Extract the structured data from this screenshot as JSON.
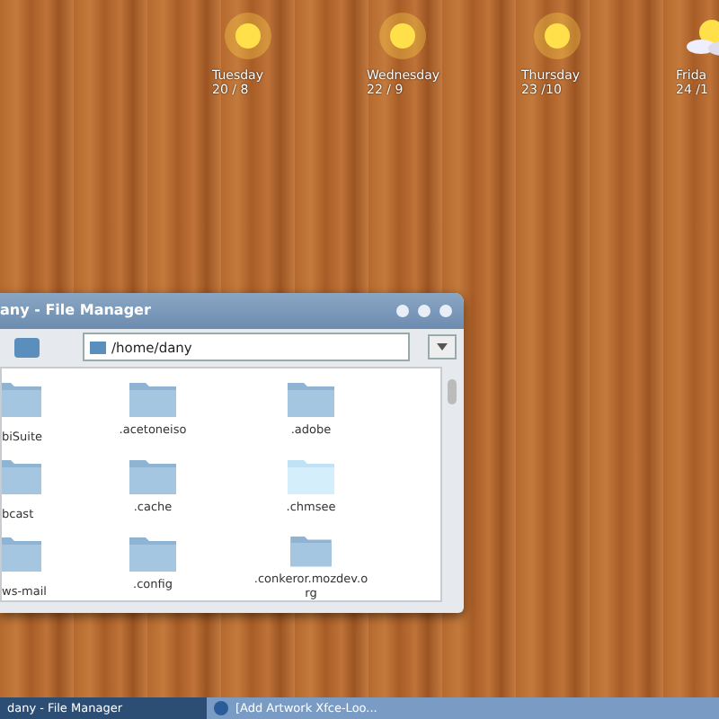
{
  "weather": [
    {
      "day": "Tuesday",
      "date": "20 / 8",
      "kind": "sunny"
    },
    {
      "day": "Wednesday",
      "date": "22 / 9",
      "kind": "sunny"
    },
    {
      "day": "Thursday",
      "date": "23 /10",
      "kind": "sunny"
    },
    {
      "day": "Frida",
      "date": "24 /1",
      "kind": "cloudy"
    }
  ],
  "window": {
    "title": "any - File Manager",
    "location": "/home/dany",
    "files": [
      {
        "name": "biSuite",
        "hovered": false
      },
      {
        "name": ".acetoneiso",
        "hovered": false
      },
      {
        "name": ".adobe",
        "hovered": false
      },
      {
        "name": "bcast",
        "hovered": false
      },
      {
        "name": ".cache",
        "hovered": false
      },
      {
        "name": ".chmsee",
        "hovered": true
      },
      {
        "name": "ws-mail",
        "hovered": false
      },
      {
        "name": ".config",
        "hovered": false
      },
      {
        "name": ".conkeror.mozdev.o rg",
        "hovered": false
      }
    ]
  },
  "taskbar": [
    {
      "label": "dany - File Manager",
      "selected": true
    },
    {
      "label": "[Add  Artwork Xfce-Loo...",
      "selected": false
    }
  ]
}
